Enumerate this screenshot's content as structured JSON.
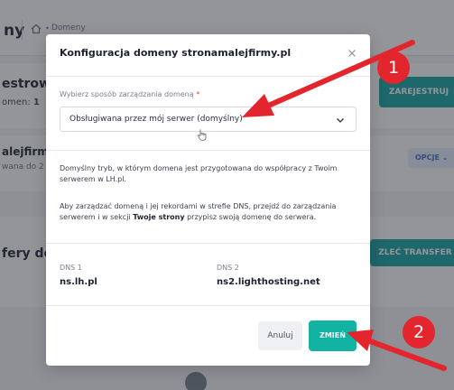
{
  "background": {
    "page_title": "ny",
    "breadcrumb": {
      "separator": "•",
      "current": "Domeny"
    },
    "section1": {
      "heading": "estrowa",
      "sub_prefix": "omen:",
      "sub_value": "1",
      "button_label": "ZAREJESTRUJ"
    },
    "section2": {
      "domain": "alejfirmy",
      "sub": "wana do 2",
      "options_label": "OPCJE"
    },
    "section3": {
      "heading": "fery do",
      "button_label": "ZLEĆ TRANSFER"
    }
  },
  "modal": {
    "title": "Konfiguracja domeny stronamalejfirmy.pl",
    "select": {
      "label": "Wybierz sposób zarządzania domeną",
      "required_mark": "*",
      "value": "Obsługiwana przez mój serwer (domyślny)"
    },
    "description": {
      "p1": "Domyślny tryb, w którym domena jest przygotowana do współpracy z Twoim serwerem w LH.pl.",
      "p2_before": "Aby zarządzać domeną i jej rekordami w strefie DNS, przejdź do zarządzania serwerem i w sekcji ",
      "p2_bold": "Twoje strony",
      "p2_after": " przypisz swoją domenę do serwera."
    },
    "dns": [
      {
        "label": "DNS 1",
        "value": "ns.lh.pl"
      },
      {
        "label": "DNS 2",
        "value": "ns2.lighthosting.net"
      }
    ],
    "buttons": {
      "cancel": "Anuluj",
      "save": "ZMIEŃ"
    }
  },
  "annotations": {
    "badge1": "1",
    "badge2": "2",
    "color": "#e3262d"
  },
  "colors": {
    "accent": "#12b3a3",
    "overlay": "rgba(40,44,52,0.5)",
    "link_blue": "#3a6fd1"
  },
  "icons": [
    "home-icon",
    "close-icon",
    "chevron-down-icon",
    "cursor-icon",
    "globe-icon"
  ]
}
